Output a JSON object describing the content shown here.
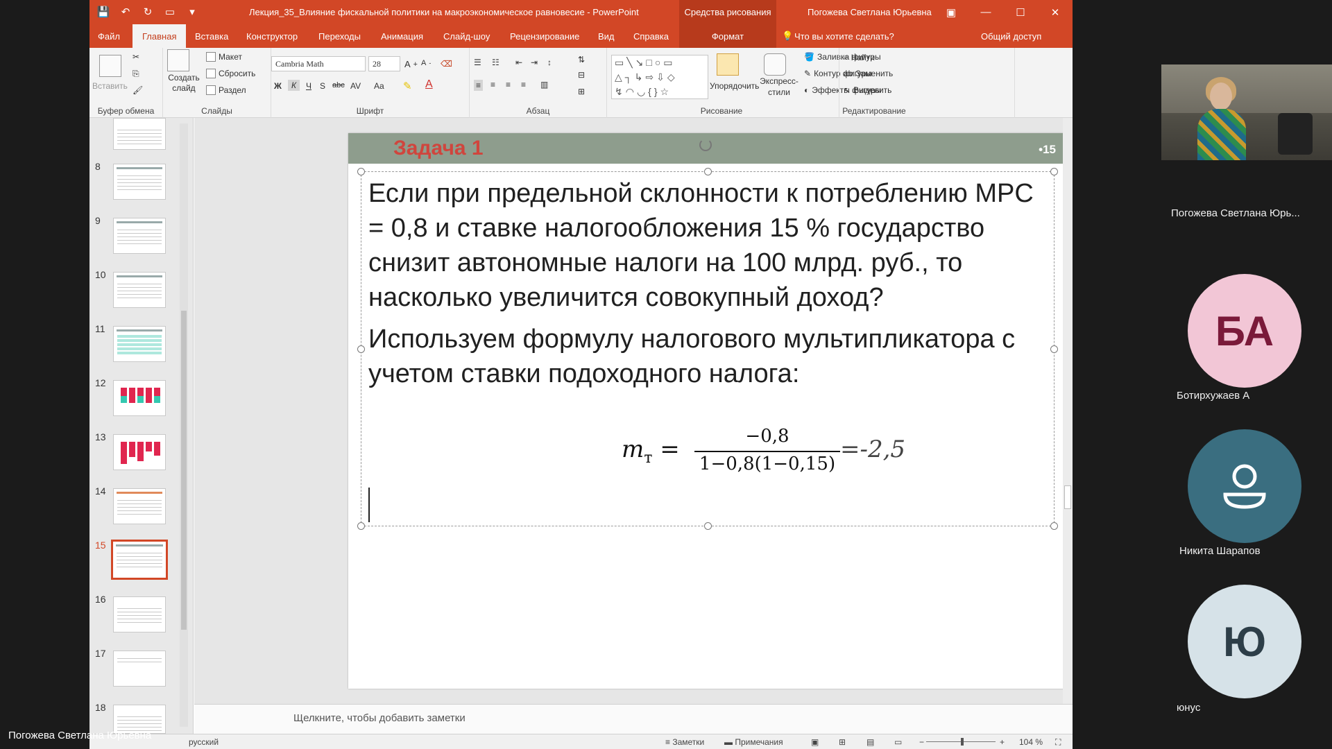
{
  "window": {
    "title": "Лекция_35_Влияние фискальной политики на макроэкономическое равновесие  -  PowerPoint",
    "context_tab": "Средства рисования",
    "user": "Погожева Светлана Юрьевна"
  },
  "tabs": {
    "file": "Файл",
    "home": "Главная",
    "insert": "Вставка",
    "design": "Конструктор",
    "transitions": "Переходы",
    "animation": "Анимация",
    "slideshow": "Слайд-шоу",
    "review": "Рецензирование",
    "view": "Вид",
    "help": "Справка",
    "format": "Формат",
    "tell_me": "Что вы хотите сделать?",
    "share": "Общий доступ"
  },
  "ribbon": {
    "clipboard": {
      "label": "Буфер обмена",
      "paste": "Вставить"
    },
    "slides": {
      "label": "Слайды",
      "new_slide": "Создать слайд",
      "layout": "Макет",
      "reset": "Сбросить",
      "section": "Раздел"
    },
    "font": {
      "label": "Шрифт",
      "font_name": "Cambria Math",
      "font_size": "28",
      "bold": "Ж",
      "italic": "К",
      "underline": "Ч",
      "shadow": "S",
      "strike": "abc",
      "spacing": "AV",
      "case": "Aa"
    },
    "paragraph": {
      "label": "Абзац"
    },
    "drawing": {
      "label": "Рисование",
      "arrange": "Упорядочить",
      "quick_styles": "Экспресс-стили",
      "shape_fill": "Заливка фигуры",
      "shape_outline": "Контур фигуры",
      "shape_effects": "Эффекты фигуры"
    },
    "editing": {
      "label": "Редактирование",
      "find": "Найти",
      "replace": "Заменить",
      "select": "Выделить"
    }
  },
  "thumbnails": [
    "8",
    "9",
    "10",
    "11",
    "12",
    "13",
    "14",
    "15",
    "16",
    "17",
    "18"
  ],
  "active_slide": "15",
  "slide": {
    "task": "Задача 1",
    "number": "•15",
    "question": "Если при предельной склонности к потреблению MPC = 0,8 и ставке налогообложения 15 % государство снизит автономные налоги на 100 млрд. руб., то насколько увеличится совокупный доход?",
    "method": "Используем формулу налогового мультипликатора с учетом ставки подоходного налога:",
    "formula": {
      "lhs": "m",
      "lhs_sub": "т",
      "eq": "=",
      "numerator": "−0,8",
      "denominator": "1−0,8(1−0,15)",
      "result": "=-2,5"
    }
  },
  "notes_placeholder": "Щелкните, чтобы добавить заметки",
  "status": {
    "language": "русский",
    "notes": "Заметки",
    "comments": "Примечания",
    "zoom": "104 %"
  },
  "call": {
    "presenter_name": "Погожева Светлана Юрь...",
    "participants": [
      {
        "initials": "БА",
        "name": "Ботирхужаев А"
      },
      {
        "initials": "",
        "name": "Никита Шарапов"
      },
      {
        "initials": "Ю",
        "name": "юнус"
      }
    ],
    "speaker_label": "Погожева Светлана Юрьевна"
  }
}
